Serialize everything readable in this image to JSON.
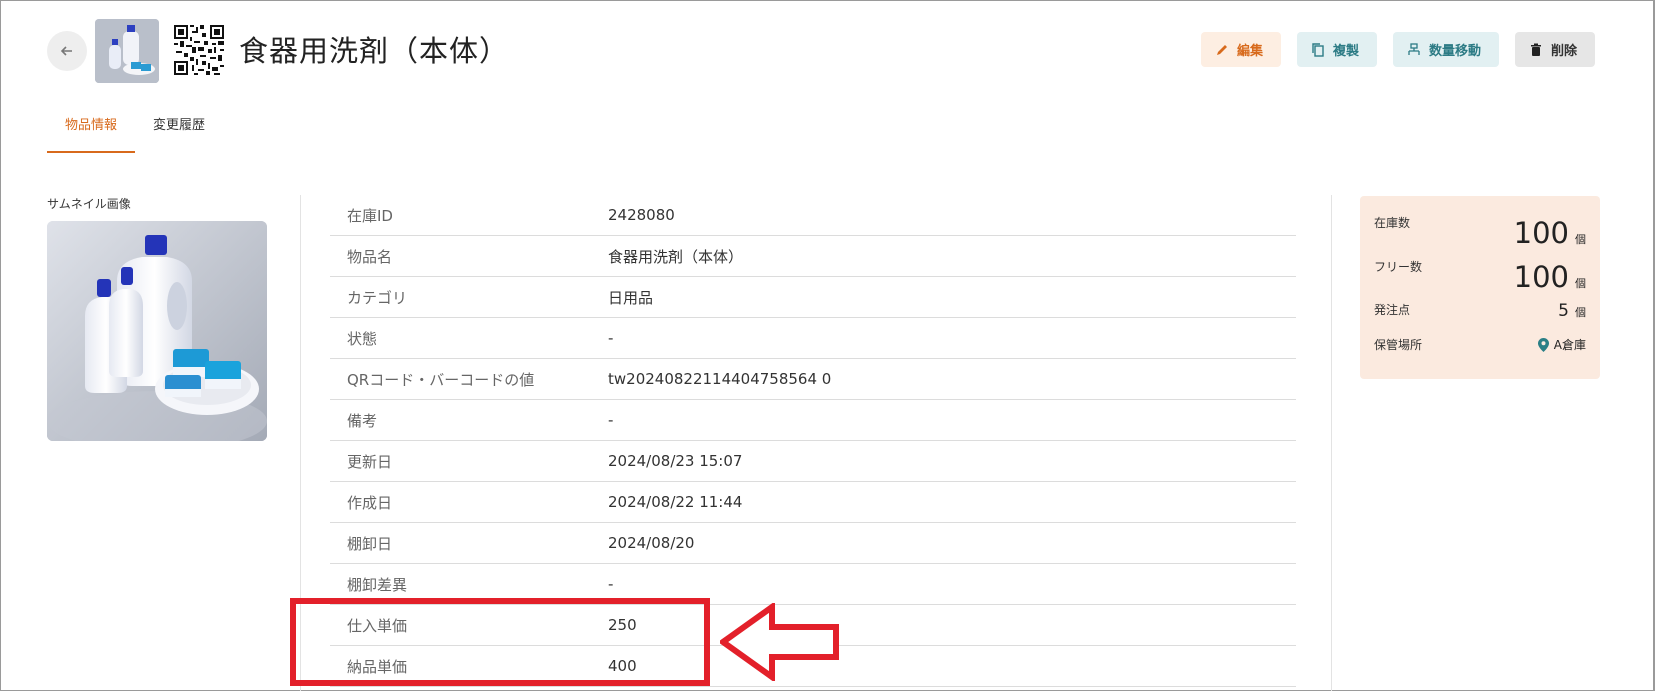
{
  "header": {
    "title": "食器用洗剤（本体）",
    "buttons": {
      "edit": "編集",
      "copy": "複製",
      "move": "数量移動",
      "delete": "削除"
    }
  },
  "tabs": [
    {
      "label": "物品情報",
      "active": true
    },
    {
      "label": "変更履歴",
      "active": false
    }
  ],
  "thumbnail": {
    "label": "サムネイル画像"
  },
  "info_rows": [
    {
      "key": "在庫ID",
      "value": "2428080"
    },
    {
      "key": "物品名",
      "value": "食器用洗剤（本体）"
    },
    {
      "key": "カテゴリ",
      "value": "日用品"
    },
    {
      "key": "状態",
      "value": "-"
    },
    {
      "key": "QRコード・バーコードの値",
      "value": "tw20240822114404758564 0"
    },
    {
      "key": "備考",
      "value": "-"
    },
    {
      "key": "更新日",
      "value": "2024/08/23 15:07"
    },
    {
      "key": "作成日",
      "value": "2024/08/22 11:44"
    },
    {
      "key": "棚卸日",
      "value": "2024/08/20"
    },
    {
      "key": "棚卸差異",
      "value": "-"
    },
    {
      "key": "仕入単価",
      "value": "250"
    },
    {
      "key": "納品単価",
      "value": "400"
    }
  ],
  "summary": {
    "stock": {
      "label": "在庫数",
      "value": "100",
      "unit": "個"
    },
    "free": {
      "label": "フリー数",
      "value": "100",
      "unit": "個"
    },
    "reorder": {
      "label": "発注点",
      "value": "5",
      "unit": "個"
    },
    "location": {
      "label": "保管場所",
      "value": "A倉庫"
    }
  },
  "colors": {
    "accent": "#d86a1c",
    "teal": "#2c7b85",
    "annotation": "#e3202a",
    "summary_bg": "#fbeadf"
  }
}
